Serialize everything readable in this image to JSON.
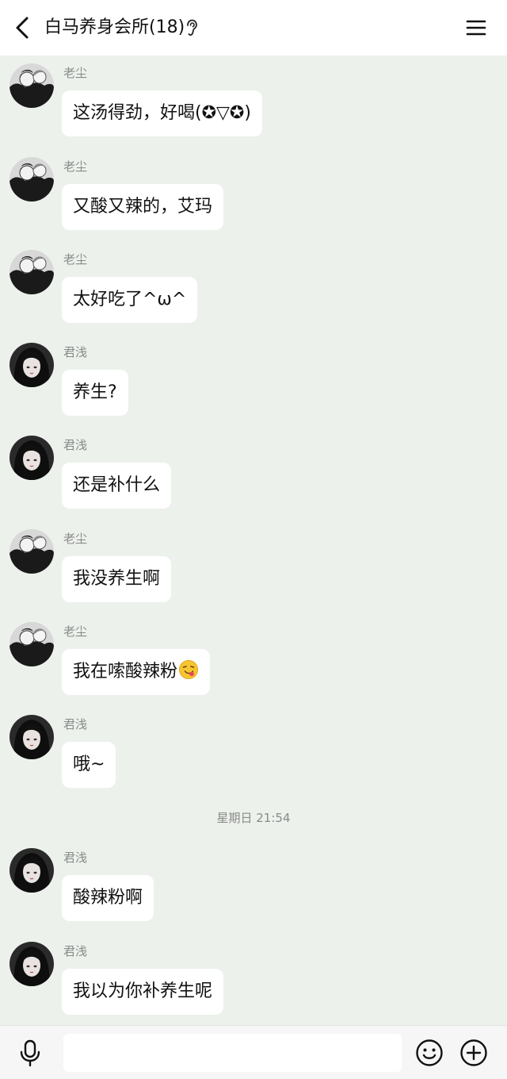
{
  "header": {
    "title": "白马养身会所(18)",
    "back_icon": "chevron-left-icon",
    "mode_icon": "ear-icon",
    "menu_icon": "hamburger-menu-icon"
  },
  "messages": [
    {
      "sender": "老尘",
      "avatar": "boys-avatar",
      "text": "这汤得劲，好喝(✪▽✪)"
    },
    {
      "sender": "老尘",
      "avatar": "boys-avatar",
      "text": "又酸又辣的，艾玛"
    },
    {
      "sender": "老尘",
      "avatar": "boys-avatar",
      "text": "太好吃了^ω^"
    },
    {
      "sender": "君浅",
      "avatar": "girl-avatar",
      "text": "养生?"
    },
    {
      "sender": "君浅",
      "avatar": "girl-avatar",
      "text": "还是补什么"
    },
    {
      "sender": "老尘",
      "avatar": "boys-avatar",
      "text": "我没养生啊"
    },
    {
      "sender": "老尘",
      "avatar": "boys-avatar",
      "text": "我在嗦酸辣粉",
      "emoji": "savoring-food-emoji"
    },
    {
      "sender": "君浅",
      "avatar": "girl-avatar",
      "text": "哦~"
    },
    {
      "sender": "君浅",
      "avatar": "girl-avatar",
      "text": "酸辣粉啊"
    },
    {
      "sender": "君浅",
      "avatar": "girl-avatar",
      "text": "我以为你补养生呢"
    }
  ],
  "timestamp": "星期日 21:54",
  "input_bar": {
    "voice_icon": "microphone-icon",
    "input_value": "",
    "emoji_icon": "smiley-icon",
    "more_icon": "plus-circle-icon"
  },
  "colors": {
    "background": "#ecf1ec",
    "bubble": "#ffffff",
    "sender_text": "#8a8a8a",
    "header_bg": "#ffffff"
  }
}
